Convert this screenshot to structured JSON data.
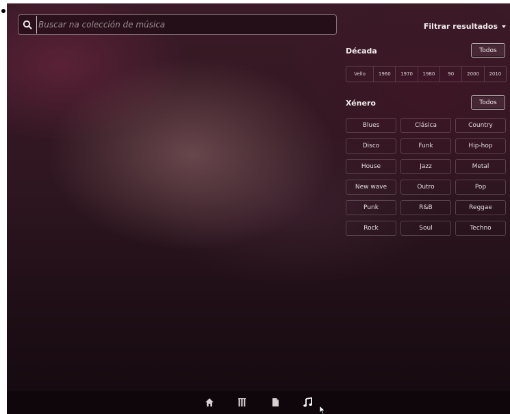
{
  "search": {
    "placeholder": "Buscar na colección de música"
  },
  "filter": {
    "toggle_label": "Filtrar resultados"
  },
  "decade": {
    "title": "Década",
    "all_label": "Todos",
    "items": [
      "Vello",
      "1960",
      "1970",
      "1980",
      "90",
      "2000",
      "2010"
    ]
  },
  "genre": {
    "title": "Xénero",
    "all_label": "Todos",
    "items": [
      "Blues",
      "Clásica",
      "Country",
      "Disco",
      "Funk",
      "Hip-hop",
      "House",
      "Jazz",
      "Metal",
      "New wave",
      "Outro",
      "Pop",
      "Punk",
      "R&B",
      "Reggae",
      "Rock",
      "Soul",
      "Techno"
    ]
  },
  "lens_bar": {
    "icons": [
      "home-icon",
      "applications-icon",
      "files-icon",
      "music-icon"
    ],
    "active": "music-icon"
  },
  "colors": {
    "background_top": "#3a1a26",
    "background_bottom": "#140a0f",
    "text": "#f1ecec",
    "button_border": "#e6dcdc"
  }
}
